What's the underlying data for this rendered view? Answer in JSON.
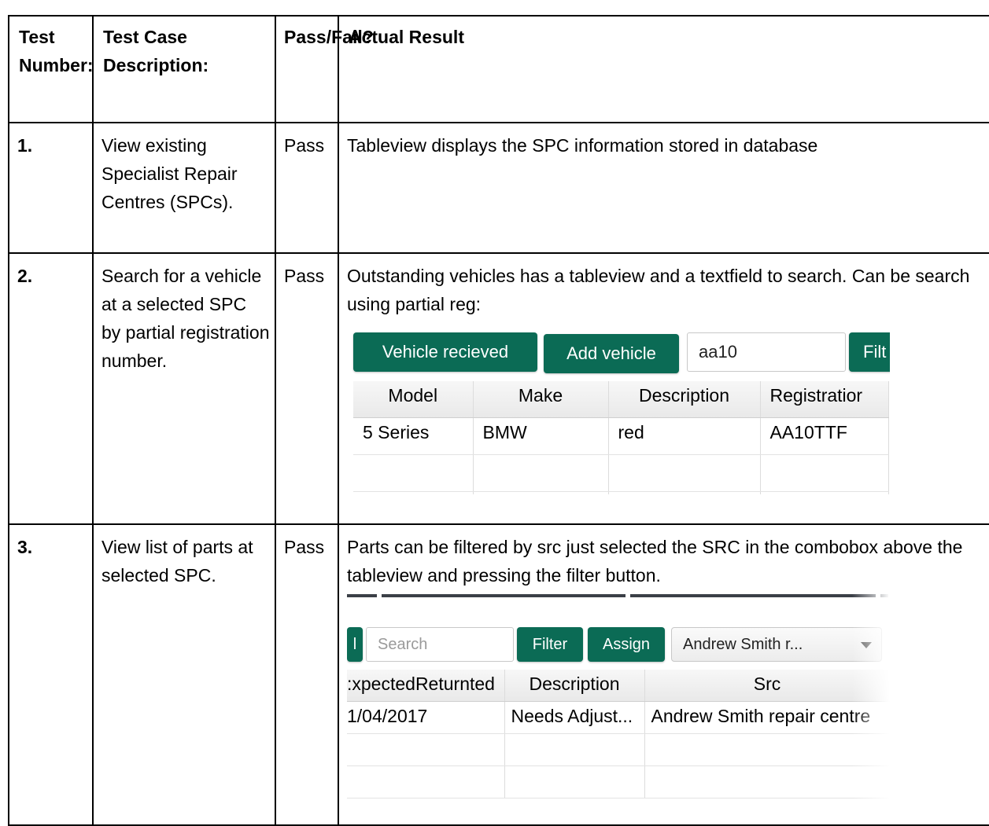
{
  "header": {
    "test_number": "Test Number:",
    "description": "Test Case Description:",
    "pass_fail": "Pass/Fail?",
    "actual_result": "Actual Result"
  },
  "rows": [
    {
      "number": "1.",
      "description": "View existing Specialist Repair Centres (SPCs).",
      "status": "Pass",
      "result": "Tableview displays the SPC information stored in database"
    },
    {
      "number": "2.",
      "description": "Search for a vehicle at a selected SPC by partial registration number.",
      "status": "Pass",
      "result": "Outstanding vehicles has a tableview and a textfield to search. Can be search using partial reg:"
    },
    {
      "number": "3.",
      "description": "View list of parts at selected SPC.",
      "status": "Pass",
      "result": "Parts can be filtered by src just selected the SRC in the combobox above the tableview and pressing the filter button."
    }
  ],
  "vehicle_screenshot": {
    "received_button": "Vehicle recieved",
    "add_button": "Add vehicle",
    "search_value": "aa10",
    "filter_button": "Filt",
    "columns": [
      "Model",
      "Make",
      "Description",
      "Registratior"
    ],
    "rows": [
      [
        "5 Series",
        "BMW",
        "red",
        "AA10TTF"
      ]
    ]
  },
  "parts_screenshot": {
    "left_button": "l",
    "search_placeholder": "Search",
    "filter_button": "Filter",
    "assign_button": "Assign",
    "combo_value": "Andrew Smith r...",
    "columns": [
      ":xpectedReturnted",
      "Description",
      "Src"
    ],
    "rows": [
      [
        "1/04/2017",
        "Needs Adjust...",
        "Andrew Smith repair centre"
      ]
    ]
  },
  "colors": {
    "button_green": "#0b6b55",
    "border": "#000000"
  }
}
